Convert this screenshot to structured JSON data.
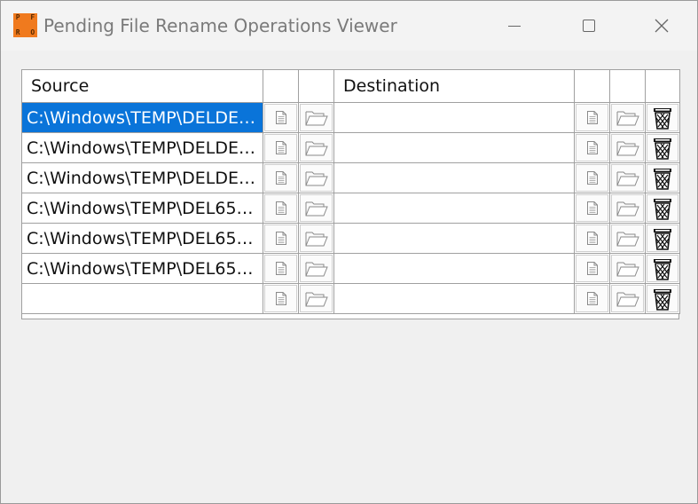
{
  "window": {
    "title": "Pending File Rename Operations Viewer",
    "app_icon_letters": [
      "P",
      "F",
      "",
      "R",
      "O",
      ""
    ]
  },
  "grid": {
    "headers": {
      "source": "Source",
      "destination": "Destination"
    },
    "rows": [
      {
        "source": "C:\\Windows\\TEMP\\DELDE…",
        "destination": "",
        "selected": true
      },
      {
        "source": "C:\\Windows\\TEMP\\DELDE…",
        "destination": ""
      },
      {
        "source": "C:\\Windows\\TEMP\\DELDE…",
        "destination": ""
      },
      {
        "source": "C:\\Windows\\TEMP\\DEL65…",
        "destination": ""
      },
      {
        "source": "C:\\Windows\\TEMP\\DEL65…",
        "destination": ""
      },
      {
        "source": "C:\\Windows\\TEMP\\DEL65…",
        "destination": ""
      },
      {
        "source": "",
        "destination": ""
      }
    ]
  },
  "icons": {
    "file": "file-icon",
    "folder": "folder-open-icon",
    "delete": "trash-icon"
  },
  "colors": {
    "selection": "#0a74d9",
    "app_icon": "#f07a1e"
  }
}
